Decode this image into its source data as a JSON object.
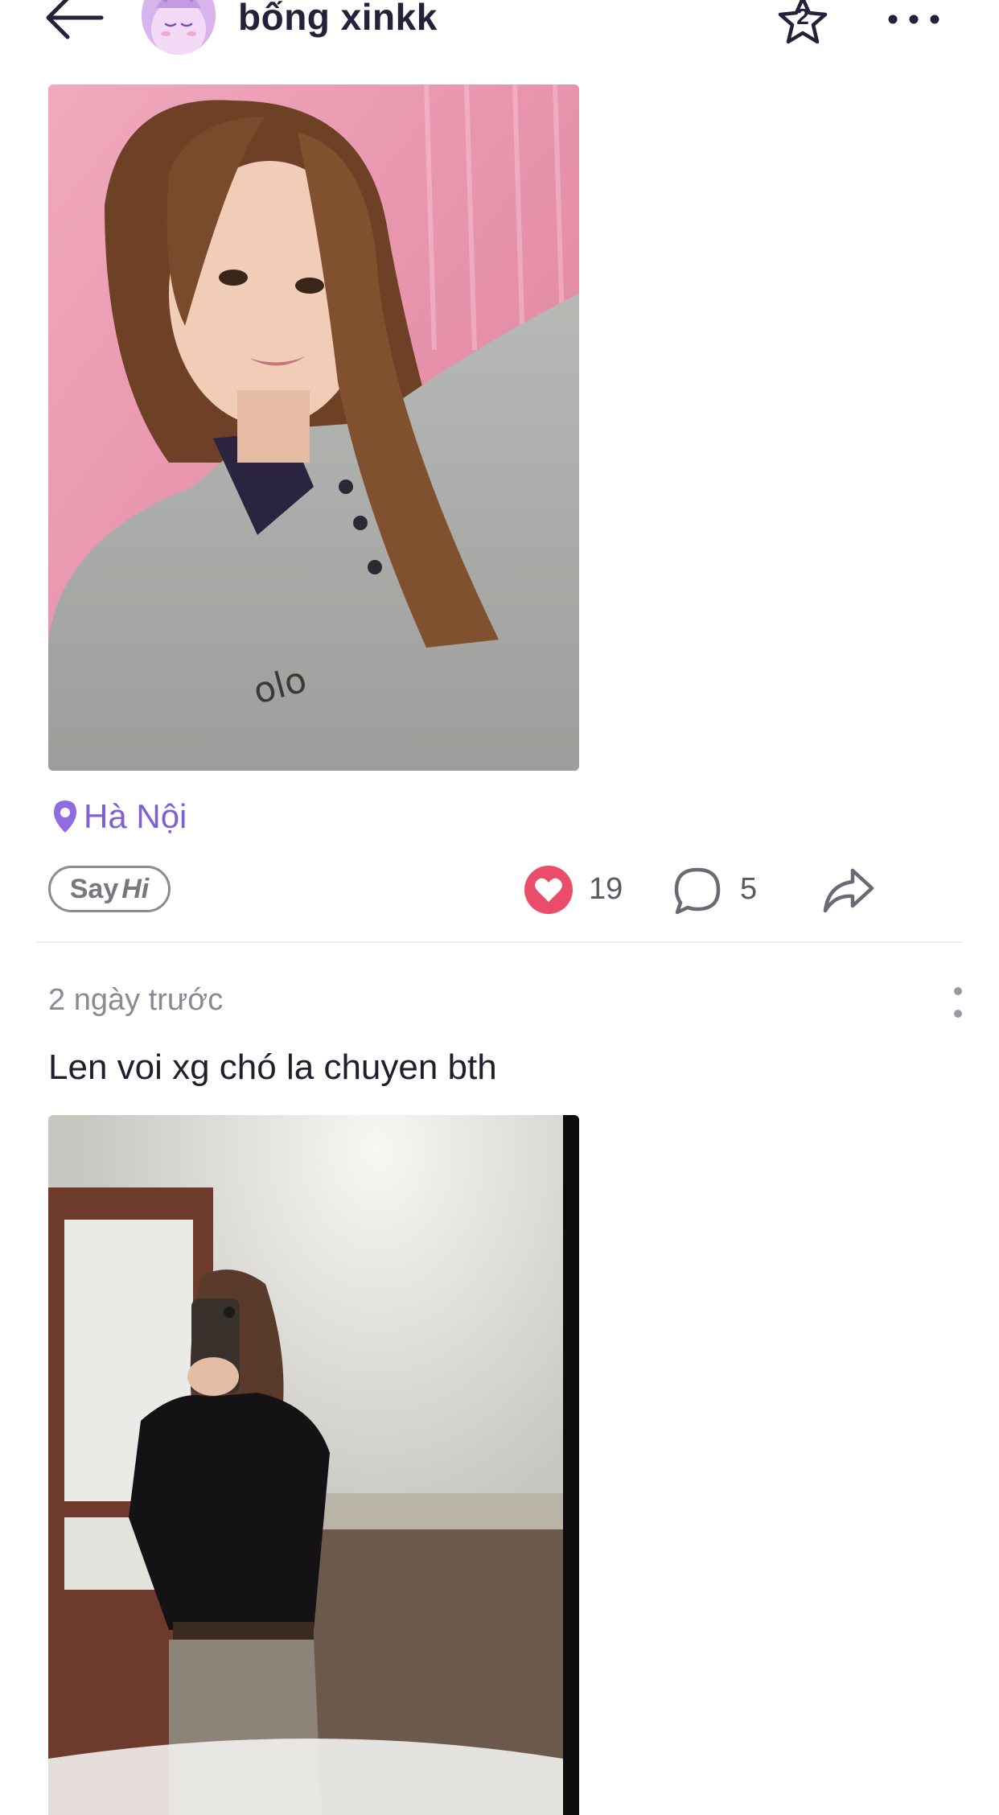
{
  "header": {
    "username": "bống xinkk",
    "star_badge": "2",
    "icons": {
      "back": "arrow-left-icon",
      "star": "star-icon",
      "more": "more-horizontal-icon"
    }
  },
  "post1": {
    "photo": "selfie-photo",
    "location": "Hà Nội",
    "say_hi": {
      "say": "Say",
      "hi": "Hi"
    },
    "like_count": "19",
    "comment_count": "5",
    "icons": {
      "location": "location-pin-icon",
      "like": "heart-icon",
      "comment": "comment-bubble-icon",
      "share": "share-arrow-icon"
    }
  },
  "post2": {
    "time": "2 ngày trước",
    "caption": "Len voi xg chó la chuyen bth",
    "photo": "mirror-selfie-photo",
    "icons": {
      "menu": "more-vertical-icon"
    }
  },
  "colors": {
    "accent_purple": "#7f5fd6",
    "like_red": "#ea4c6a",
    "text_dark": "#1f1f2e",
    "text_gray": "#8a8a94"
  }
}
